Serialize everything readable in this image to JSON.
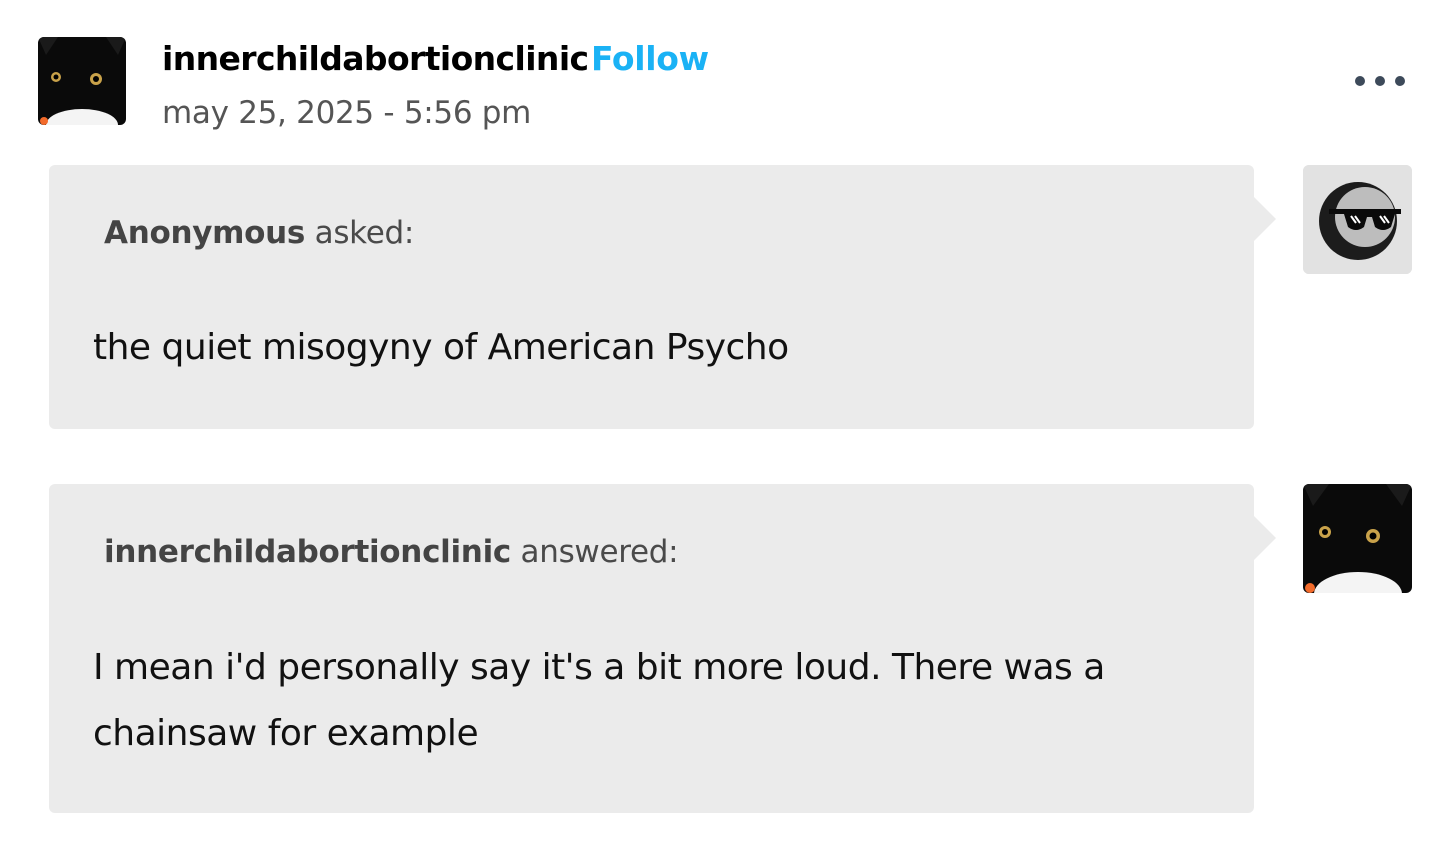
{
  "post": {
    "username": "innerchildabortionclinic",
    "follow_label": "Follow",
    "timestamp": "may 25, 2025 - 5:56 pm"
  },
  "question": {
    "asker": "Anonymous",
    "verb": " asked:",
    "text": "the quiet misogyny of American Psycho"
  },
  "answer": {
    "answerer": "innerchildabortionclinic",
    "verb": " answered:",
    "text": "I mean i'd personally say it's a bit more loud. There was a chainsaw for example"
  },
  "icons": {
    "more": "more-options-icon",
    "anon_avatar": "sunglasses-face-icon",
    "user_avatar": "black-cat-avatar"
  },
  "colors": {
    "follow": "#1ab2f5",
    "bubble_bg": "#ebebeb",
    "timestamp": "#555555"
  }
}
